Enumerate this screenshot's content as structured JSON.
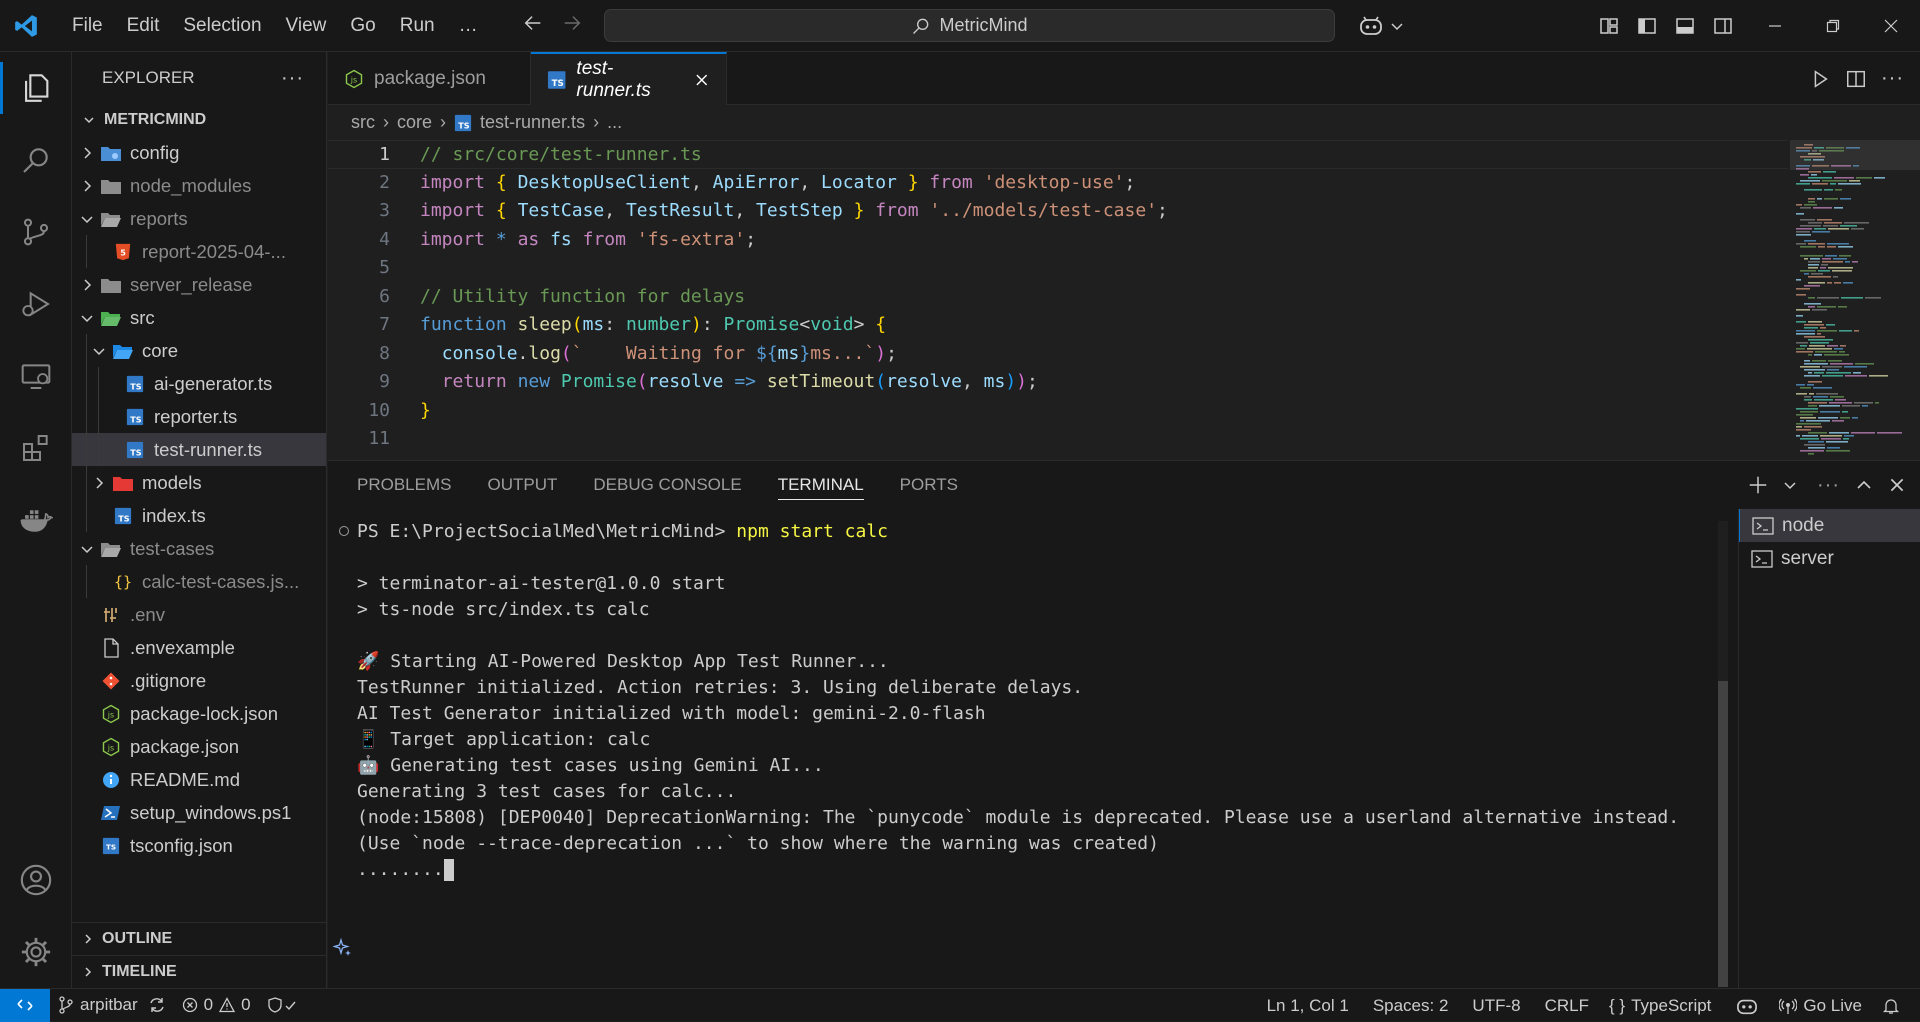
{
  "titlebar": {
    "menu": [
      "File",
      "Edit",
      "Selection",
      "View",
      "Go",
      "Run",
      "…"
    ],
    "search": "MetricMind"
  },
  "sidebar": {
    "title": "EXPLORER",
    "project": "METRICMIND",
    "tree": [
      {
        "label": "config",
        "depth": 1,
        "chevron": "right",
        "icon": "gear-folder-icon",
        "dim": false
      },
      {
        "label": "node_modules",
        "depth": 1,
        "chevron": "right",
        "icon": "folder-icon",
        "dim": true
      },
      {
        "label": "reports",
        "depth": 1,
        "chevron": "down",
        "icon": "folder-open-icon",
        "dim": true
      },
      {
        "label": "report-2025-04-...",
        "depth": 2,
        "chevron": "",
        "icon": "html-file-icon",
        "dim": true
      },
      {
        "label": "server_release",
        "depth": 1,
        "chevron": "right",
        "icon": "folder-icon",
        "dim": true
      },
      {
        "label": "src",
        "depth": 1,
        "chevron": "down",
        "icon": "src-folder-icon",
        "dim": false
      },
      {
        "label": "core",
        "depth": 2,
        "chevron": "down",
        "icon": "core-folder-icon",
        "dim": false
      },
      {
        "label": "ai-generator.ts",
        "depth": 3,
        "chevron": "",
        "icon": "ts-file-icon",
        "dim": false
      },
      {
        "label": "reporter.ts",
        "depth": 3,
        "chevron": "",
        "icon": "ts-file-icon",
        "dim": false
      },
      {
        "label": "test-runner.ts",
        "depth": 3,
        "chevron": "",
        "icon": "ts-file-icon",
        "dim": false,
        "selected": true
      },
      {
        "label": "models",
        "depth": 2,
        "chevron": "right",
        "icon": "models-folder-icon",
        "dim": false
      },
      {
        "label": "index.ts",
        "depth": 2,
        "chevron": "",
        "icon": "ts-file-icon",
        "dim": false
      },
      {
        "label": "test-cases",
        "depth": 1,
        "chevron": "down",
        "icon": "folder-open-icon",
        "dim": true
      },
      {
        "label": "calc-test-cases.js...",
        "depth": 2,
        "chevron": "",
        "icon": "json-file-icon",
        "dim": true
      },
      {
        "label": ".env",
        "depth": 1,
        "chevron": "",
        "icon": "env-file-icon",
        "dim": true
      },
      {
        "label": ".envexample",
        "depth": 1,
        "chevron": "",
        "icon": "file-icon",
        "dim": false
      },
      {
        "label": ".gitignore",
        "depth": 1,
        "chevron": "",
        "icon": "git-file-icon",
        "dim": false
      },
      {
        "label": "package-lock.json",
        "depth": 1,
        "chevron": "",
        "icon": "node-file-icon",
        "dim": false
      },
      {
        "label": "package.json",
        "depth": 1,
        "chevron": "",
        "icon": "node-file-icon",
        "dim": false
      },
      {
        "label": "README.md",
        "depth": 1,
        "chevron": "",
        "icon": "info-file-icon",
        "dim": false
      },
      {
        "label": "setup_windows.ps1",
        "depth": 1,
        "chevron": "",
        "icon": "powershell-file-icon",
        "dim": false
      },
      {
        "label": "tsconfig.json",
        "depth": 1,
        "chevron": "",
        "icon": "tsconfig-file-icon",
        "dim": false
      }
    ],
    "outline": "OUTLINE",
    "timeline": "TIMELINE"
  },
  "editor": {
    "tabs": [
      {
        "label": "package.json",
        "active": false
      },
      {
        "label": "test-runner.ts",
        "active": true
      }
    ],
    "breadcrumb": [
      "src",
      "core",
      "test-runner.ts",
      "..."
    ],
    "line_numbers": [
      "1",
      "2",
      "3",
      "4",
      "5",
      "6",
      "7",
      "8",
      "9",
      "10",
      "11"
    ]
  },
  "panel": {
    "tabs": [
      "PROBLEMS",
      "OUTPUT",
      "DEBUG CONSOLE",
      "TERMINAL",
      "PORTS"
    ],
    "active_tab": "TERMINAL",
    "terminal": {
      "prompt": "PS E:\\ProjectSocialMed\\MetricMind> ",
      "command": "npm start calc",
      "lines": [
        "",
        "> terminator-ai-tester@1.0.0 start",
        "> ts-node src/index.ts calc",
        "",
        "🚀 Starting AI-Powered Desktop App Test Runner...",
        "TestRunner initialized. Action retries: 3. Using deliberate delays.",
        "AI Test Generator initialized with model: gemini-2.0-flash",
        "📱 Target application: calc",
        "🤖 Generating test cases using Gemini AI...",
        "Generating 3 test cases for calc...",
        "(node:15808) [DEP0040] DeprecationWarning: The `punycode` module is deprecated. Please use a userland alternative instead.",
        "(Use `node --trace-deprecation ...` to show where the warning was created)"
      ],
      "progress": "........"
    },
    "terminals": [
      {
        "label": "node",
        "active": true
      },
      {
        "label": "server",
        "active": false
      }
    ]
  },
  "statusbar": {
    "branch": "arpitbar",
    "errors": "0",
    "warnings": "0",
    "cursor": "Ln 1, Col 1",
    "spaces": "Spaces: 2",
    "encoding": "UTF-8",
    "eol": "CRLF",
    "language": "TypeScript",
    "golive": "Go Live"
  },
  "colors": {
    "accent": "#0078d4",
    "selection": "#37373d"
  }
}
